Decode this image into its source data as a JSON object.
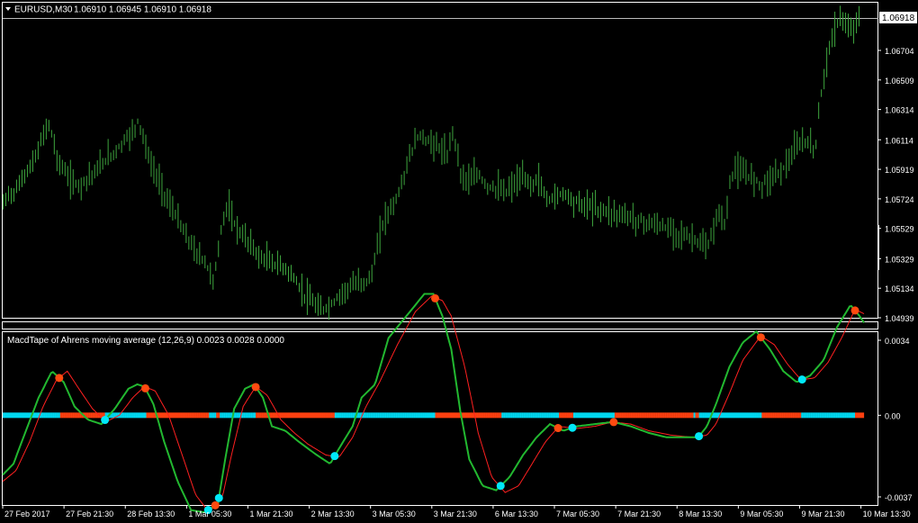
{
  "main": {
    "symbol_label": "EURUSD,M30",
    "ohlc": "1.06910 1.06945 1.06910 1.06918",
    "current_price": "1.06918",
    "bar_color": "#3ea63e",
    "y_ticks": [
      "1.06704",
      "1.06509",
      "1.06314",
      "1.06114",
      "1.05919",
      "1.05724",
      "1.05529",
      "1.05329",
      "1.05134",
      "1.04939"
    ]
  },
  "indicator": {
    "label": "MacdTape of Ahrens moving average (12,26,9) 0.0023 0.0028 0.0000",
    "y_ticks": [
      "0.0034",
      "0.00",
      "-0.0037"
    ]
  },
  "x_ticks": [
    "27 Feb 2017",
    "27 Feb 21:30",
    "28 Feb 13:30",
    "1 Mar 05:30",
    "1 Mar 21:30",
    "2 Mar 13:30",
    "3 Mar 05:30",
    "3 Mar 21:30",
    "6 Mar 13:30",
    "7 Mar 05:30",
    "7 Mar 21:30",
    "8 Mar 13:30",
    "9 Mar 05:30",
    "9 Mar 21:30",
    "10 Mar 13:30"
  ],
  "colors": {
    "grid": "#ffffff",
    "macd": "#22b830",
    "signal": "#ff2020",
    "tape_up": "#00d8f0",
    "tape_down": "#ff4010",
    "dot_up": "#00e8f8",
    "dot_down": "#ff4a10"
  },
  "chart_data": [
    {
      "type": "bar",
      "title": "EURUSD,M30",
      "x_start": "27 Feb 2017",
      "x_end": "10 Mar 13:30",
      "ylim": [
        1.04939,
        1.06918
      ],
      "close_path": [
        [
          0,
          1.057
        ],
        [
          5,
          1.0575
        ],
        [
          15,
          1.058
        ],
        [
          25,
          1.059
        ],
        [
          35,
          1.06
        ],
        [
          45,
          1.0615
        ],
        [
          50,
          1.0625
        ],
        [
          55,
          1.0615
        ],
        [
          60,
          1.06
        ],
        [
          65,
          1.0595
        ],
        [
          75,
          1.0585
        ],
        [
          85,
          1.0582
        ],
        [
          95,
          1.0588
        ],
        [
          105,
          1.0593
        ],
        [
          115,
          1.06
        ],
        [
          125,
          1.0605
        ],
        [
          135,
          1.0612
        ],
        [
          145,
          1.0618
        ],
        [
          150,
          1.0625
        ],
        [
          155,
          1.0618
        ],
        [
          160,
          1.0605
        ],
        [
          165,
          1.0595
        ],
        [
          175,
          1.0583
        ],
        [
          185,
          1.057
        ],
        [
          195,
          1.056
        ],
        [
          205,
          1.0548
        ],
        [
          215,
          1.0538
        ],
        [
          225,
          1.0532
        ],
        [
          235,
          1.052
        ],
        [
          240,
          1.054
        ],
        [
          245,
          1.056
        ],
        [
          250,
          1.057
        ],
        [
          255,
          1.056
        ],
        [
          265,
          1.055
        ],
        [
          275,
          1.0545
        ],
        [
          285,
          1.0535
        ],
        [
          295,
          1.0533
        ],
        [
          305,
          1.053
        ],
        [
          315,
          1.0528
        ],
        [
          325,
          1.052
        ],
        [
          335,
          1.051
        ],
        [
          345,
          1.0505
        ],
        [
          355,
          1.05
        ],
        [
          365,
          1.0503
        ],
        [
          375,
          1.051
        ],
        [
          385,
          1.0515
        ],
        [
          395,
          1.0518
        ],
        [
          405,
          1.052
        ],
        [
          410,
          1.0522
        ],
        [
          415,
          1.0535
        ],
        [
          420,
          1.055
        ],
        [
          425,
          1.056
        ],
        [
          430,
          1.0565
        ],
        [
          440,
          1.0575
        ],
        [
          445,
          1.0585
        ],
        [
          450,
          1.0595
        ],
        [
          455,
          1.0605
        ],
        [
          460,
          1.0612
        ],
        [
          465,
          1.0617
        ],
        [
          470,
          1.0612
        ],
        [
          480,
          1.061
        ],
        [
          490,
          1.0605
        ],
        [
          495,
          1.06
        ],
        [
          500,
          1.062
        ],
        [
          505,
          1.061
        ],
        [
          510,
          1.059
        ],
        [
          520,
          1.0585
        ],
        [
          530,
          1.059
        ],
        [
          535,
          1.0585
        ],
        [
          540,
          1.0582
        ],
        [
          550,
          1.058
        ],
        [
          560,
          1.0578
        ],
        [
          570,
          1.0583
        ],
        [
          580,
          1.0587
        ],
        [
          590,
          1.0583
        ],
        [
          595,
          1.0588
        ],
        [
          600,
          1.0582
        ],
        [
          605,
          1.0572
        ],
        [
          615,
          1.0575
        ],
        [
          625,
          1.0578
        ],
        [
          635,
          1.0573
        ],
        [
          645,
          1.057
        ],
        [
          655,
          1.0568
        ],
        [
          665,
          1.0567
        ],
        [
          675,
          1.0565
        ],
        [
          685,
          1.0563
        ],
        [
          695,
          1.0562
        ],
        [
          705,
          1.056
        ],
        [
          715,
          1.0558
        ],
        [
          725,
          1.0557
        ],
        [
          735,
          1.0555
        ],
        [
          745,
          1.0553
        ],
        [
          755,
          1.055
        ],
        [
          765,
          1.0548
        ],
        [
          775,
          1.0545
        ],
        [
          785,
          1.054
        ],
        [
          790,
          1.055
        ],
        [
          795,
          1.056
        ],
        [
          800,
          1.0565
        ],
        [
          805,
          1.0555
        ],
        [
          810,
          1.0583
        ],
        [
          815,
          1.0593
        ],
        [
          825,
          1.059
        ],
        [
          835,
          1.0588
        ],
        [
          845,
          1.0583
        ],
        [
          855,
          1.0587
        ],
        [
          865,
          1.0592
        ],
        [
          875,
          1.0597
        ],
        [
          885,
          1.0608
        ],
        [
          895,
          1.0612
        ],
        [
          905,
          1.0605
        ],
        [
          910,
          1.0635
        ],
        [
          915,
          1.0655
        ],
        [
          920,
          1.0672
        ],
        [
          925,
          1.068
        ],
        [
          930,
          1.069
        ],
        [
          935,
          1.0695
        ],
        [
          940,
          1.0685
        ],
        [
          945,
          1.0685
        ],
        [
          950,
          1.069
        ],
        [
          955,
          1.0693
        ],
        [
          960,
          1.0692
        ]
      ]
    },
    {
      "type": "line",
      "title": "MacdTape of Ahrens moving average (12,26,9) 0.0023 0.0028 0.0000",
      "ylim": [
        -0.0037,
        0.0034
      ],
      "series": [
        {
          "values": [
            [
              0,
              -0.0027
            ],
            [
              12,
              -0.0022
            ],
            [
              25,
              -0.0008
            ],
            [
              40,
              0.0008
            ],
            [
              55,
              0.002
            ],
            [
              68,
              0.0015
            ],
            [
              80,
              0.0004
            ],
            [
              95,
              -0.0002
            ],
            [
              110,
              -0.0004
            ],
            [
              125,
              0.0003
            ],
            [
              140,
              0.0012
            ],
            [
              150,
              0.0014
            ],
            [
              158,
              0.0013
            ],
            [
              168,
              0.0005
            ],
            [
              180,
              -0.0012
            ],
            [
              195,
              -0.003
            ],
            [
              210,
              -0.0043
            ],
            [
              225,
              -0.0044
            ],
            [
              240,
              -0.004
            ],
            [
              248,
              -0.002
            ],
            [
              258,
              0.0003
            ],
            [
              270,
              0.0012
            ],
            [
              280,
              0.0014
            ],
            [
              290,
              0.0008
            ],
            [
              300,
              -0.0005
            ],
            [
              315,
              -0.0007
            ],
            [
              330,
              -0.0012
            ],
            [
              350,
              -0.0018
            ],
            [
              365,
              -0.0022
            ],
            [
              375,
              -0.0015
            ],
            [
              390,
              -0.0005
            ],
            [
              400,
              0.0008
            ],
            [
              415,
              0.0014
            ],
            [
              430,
              0.0035
            ],
            [
              450,
              0.0045
            ],
            [
              470,
              0.0055
            ],
            [
              480,
              0.0055
            ],
            [
              490,
              0.0045
            ],
            [
              500,
              0.003
            ],
            [
              510,
              0.0002
            ],
            [
              520,
              -0.002
            ],
            [
              535,
              -0.0032
            ],
            [
              550,
              -0.0034
            ],
            [
              565,
              -0.0028
            ],
            [
              580,
              -0.0018
            ],
            [
              595,
              -0.001
            ],
            [
              610,
              -0.0004
            ],
            [
              625,
              -0.0007
            ],
            [
              640,
              -0.0005
            ],
            [
              660,
              -0.0004
            ],
            [
              680,
              -0.0003
            ],
            [
              700,
              -0.0005
            ],
            [
              720,
              -0.0008
            ],
            [
              740,
              -0.001
            ],
            [
              760,
              -0.001
            ],
            [
              775,
              -0.001
            ],
            [
              785,
              -0.0005
            ],
            [
              795,
              0.0005
            ],
            [
              810,
              0.0022
            ],
            [
              825,
              0.0033
            ],
            [
              840,
              0.0038
            ],
            [
              855,
              0.003
            ],
            [
              870,
              0.002
            ],
            [
              885,
              0.0015
            ],
            [
              900,
              0.0018
            ],
            [
              915,
              0.0025
            ],
            [
              930,
              0.004
            ],
            [
              945,
              0.005
            ],
            [
              955,
              0.0045
            ],
            [
              960,
              0.0042
            ]
          ]
        },
        {
          "values": [
            [
              0,
              -0.003
            ],
            [
              15,
              -0.0025
            ],
            [
              30,
              -0.0012
            ],
            [
              45,
              0.0004
            ],
            [
              60,
              0.0016
            ],
            [
              72,
              0.002
            ],
            [
              85,
              0.0012
            ],
            [
              100,
              0.0003
            ],
            [
              115,
              -0.0003
            ],
            [
              130,
              0.0
            ],
            [
              145,
              0.0008
            ],
            [
              158,
              0.0013
            ],
            [
              170,
              0.0011
            ],
            [
              185,
              0.0
            ],
            [
              200,
              -0.0018
            ],
            [
              215,
              -0.0036
            ],
            [
              230,
              -0.0044
            ],
            [
              245,
              -0.0037
            ],
            [
              255,
              -0.0018
            ],
            [
              268,
              0.0004
            ],
            [
              282,
              0.0013
            ],
            [
              295,
              0.0009
            ],
            [
              310,
              -0.0002
            ],
            [
              325,
              -0.0008
            ],
            [
              340,
              -0.0013
            ],
            [
              360,
              -0.0018
            ],
            [
              375,
              -0.0019
            ],
            [
              390,
              -0.001
            ],
            [
              405,
              0.0004
            ],
            [
              420,
              0.0015
            ],
            [
              440,
              0.0032
            ],
            [
              460,
              0.0047
            ],
            [
              478,
              0.0054
            ],
            [
              490,
              0.0052
            ],
            [
              500,
              0.0045
            ],
            [
              515,
              0.0022
            ],
            [
              530,
              -0.0008
            ],
            [
              545,
              -0.0028
            ],
            [
              560,
              -0.0035
            ],
            [
              575,
              -0.0032
            ],
            [
              590,
              -0.0022
            ],
            [
              605,
              -0.0012
            ],
            [
              620,
              -0.0005
            ],
            [
              640,
              -0.0006
            ],
            [
              660,
              -0.0005
            ],
            [
              680,
              -0.0003
            ],
            [
              700,
              -0.0004
            ],
            [
              720,
              -0.0007
            ],
            [
              745,
              -0.0009
            ],
            [
              770,
              -0.001
            ],
            [
              785,
              -0.0009
            ],
            [
              795,
              -0.0004
            ],
            [
              810,
              0.001
            ],
            [
              825,
              0.0025
            ],
            [
              845,
              0.0036
            ],
            [
              860,
              0.0032
            ],
            [
              875,
              0.0023
            ],
            [
              890,
              0.0016
            ],
            [
              905,
              0.0017
            ],
            [
              920,
              0.0024
            ],
            [
              935,
              0.0035
            ],
            [
              950,
              0.0048
            ],
            [
              960,
              0.0046
            ]
          ]
        }
      ]
    }
  ]
}
